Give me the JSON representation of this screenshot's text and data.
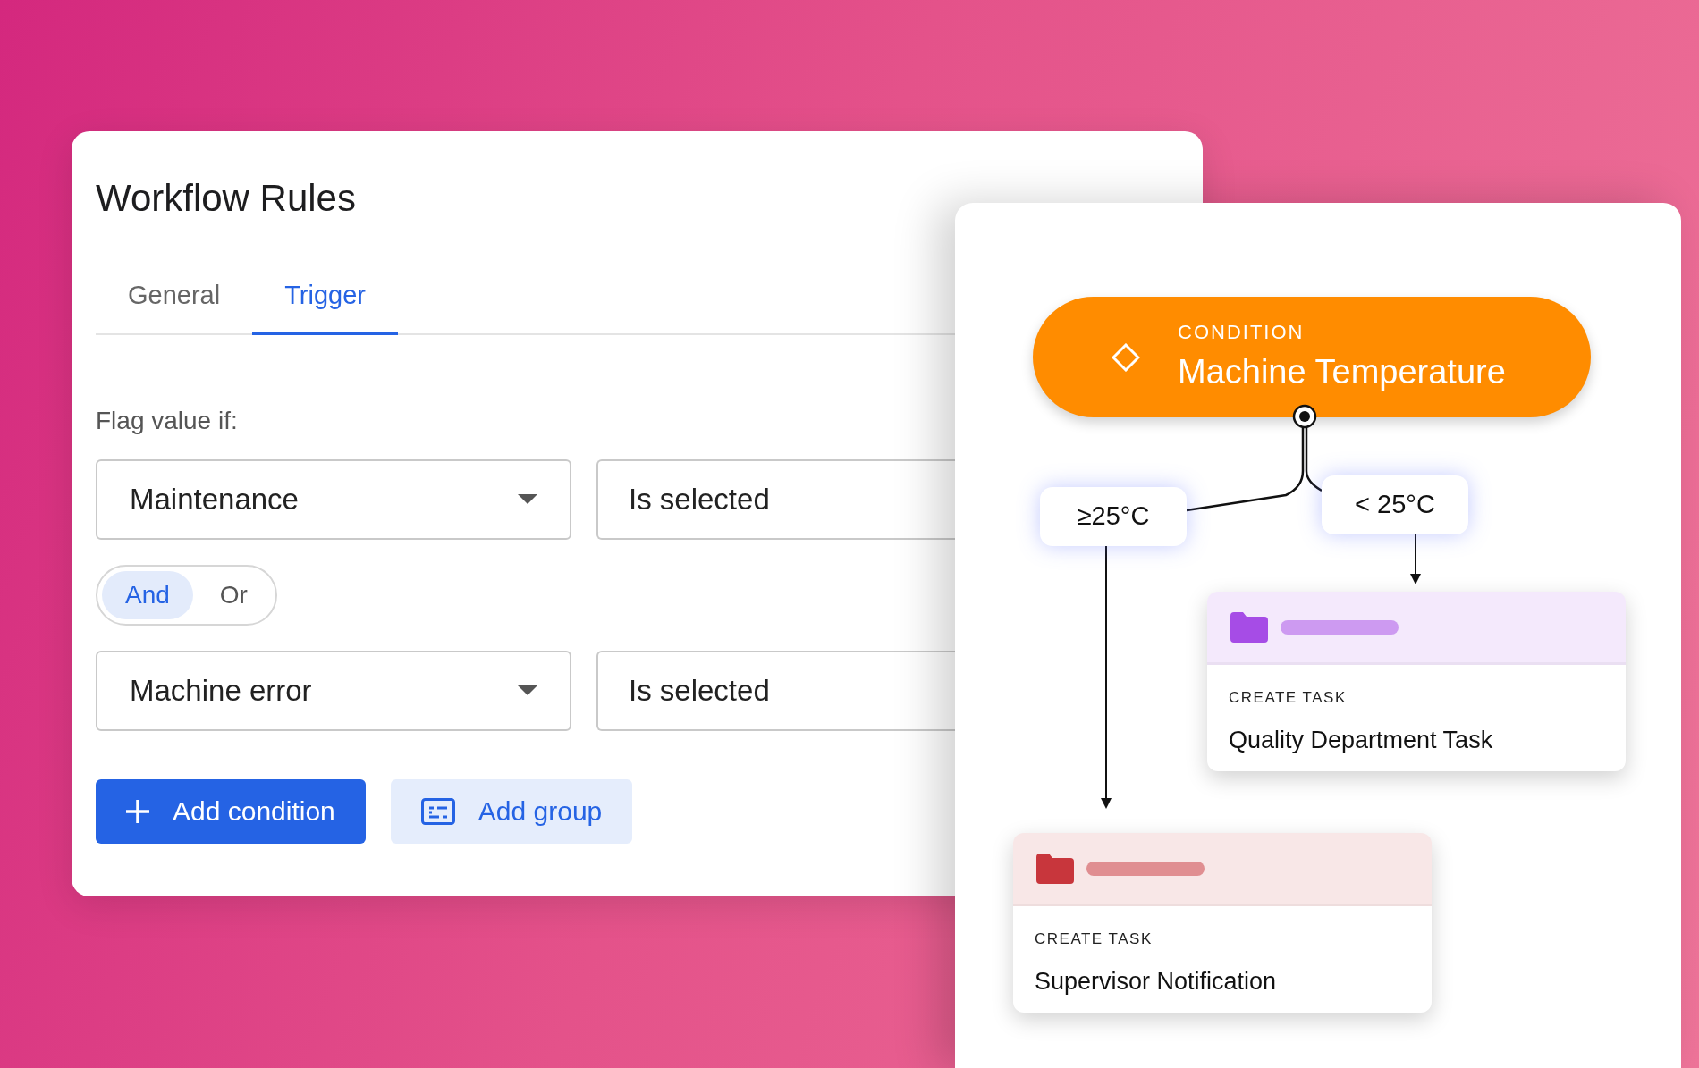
{
  "window": {
    "title": "Workflow Rules"
  },
  "tabs": [
    {
      "label": "General",
      "selected": false
    },
    {
      "label": "Trigger",
      "selected": true
    }
  ],
  "flag_label": "Flag value if:",
  "conditions": [
    {
      "field": "Maintenance",
      "operator": "Is selected"
    },
    {
      "field": "Machine error",
      "operator": "Is selected"
    }
  ],
  "logic_toggle": [
    {
      "label": "And",
      "selected": true
    },
    {
      "label": "Or",
      "selected": false
    }
  ],
  "buttons": [
    {
      "label": "Add condition",
      "kind": "primary"
    },
    {
      "label": "Add group",
      "kind": "secondary"
    }
  ],
  "flow": {
    "condition": {
      "caption": "CONDITION",
      "title": "Machine Temperature"
    },
    "branches": [
      {
        "label": "≥25°C"
      },
      {
        "label": "< 25°C"
      }
    ],
    "tasks": [
      {
        "caption": "CREATE TASK",
        "title": "Quality Department Task",
        "color": "#a64ce6"
      },
      {
        "caption": "CREATE TASK",
        "title": "Supervisor Notification",
        "color": "#c8363c"
      }
    ]
  }
}
